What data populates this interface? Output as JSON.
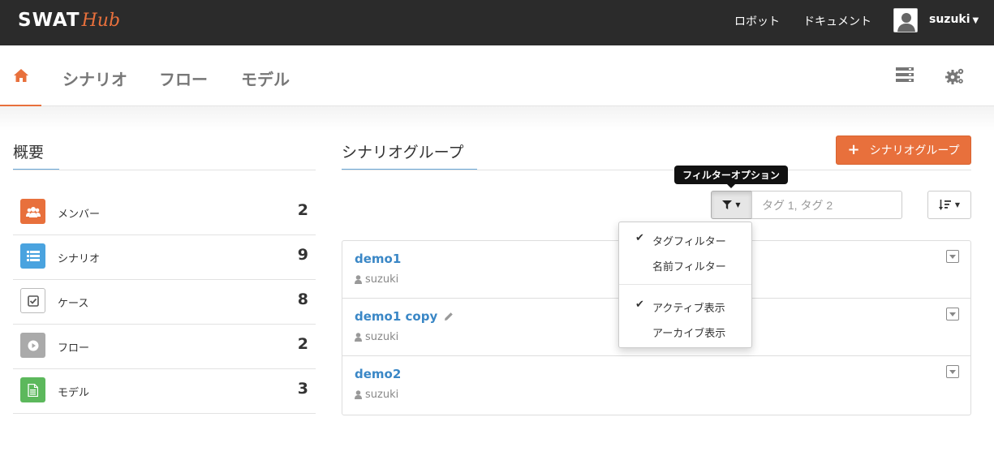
{
  "topbar": {
    "logo_main": "SWAT",
    "logo_sub": "Hub",
    "links": [
      "ロボット",
      "ドキュメント"
    ],
    "user": "suzuki"
  },
  "subnav": {
    "home_icon": "home-icon",
    "tabs": [
      "シナリオ",
      "フロー",
      "モデル"
    ]
  },
  "overview": {
    "title": "概要",
    "stats": [
      {
        "label": "メンバー",
        "count": "2",
        "icon": "members-icon",
        "color": "#e8703c"
      },
      {
        "label": "シナリオ",
        "count": "9",
        "icon": "list-icon",
        "color": "#4aa3df"
      },
      {
        "label": "ケース",
        "count": "8",
        "icon": "checkbox-icon",
        "color": "#ffffff"
      },
      {
        "label": "フロー",
        "count": "2",
        "icon": "play-icon",
        "color": "#aaaaaa"
      },
      {
        "label": "モデル",
        "count": "3",
        "icon": "document-icon",
        "color": "#5cb85c"
      }
    ]
  },
  "scenario_groups": {
    "title": "シナリオグループ",
    "add_button": "シナリオグループ",
    "filter_tooltip": "フィルターオプション",
    "tag_placeholder": "タグ 1, タグ 2",
    "items": [
      {
        "name": "demo1",
        "user": "suzuki"
      },
      {
        "name": "demo1 copy",
        "user": "suzuki"
      },
      {
        "name": "demo2",
        "user": "suzuki"
      }
    ]
  },
  "filter_menu": {
    "items": [
      {
        "label": "タグフィルター",
        "checked": true
      },
      {
        "label": "名前フィルター",
        "checked": false
      },
      {
        "label": "アクティブ表示",
        "checked": true
      },
      {
        "label": "アーカイブ表示",
        "checked": false
      }
    ]
  },
  "colors": {
    "accent": "#e8703c",
    "link": "#3a87c6",
    "topbar": "#2b2b2b"
  }
}
